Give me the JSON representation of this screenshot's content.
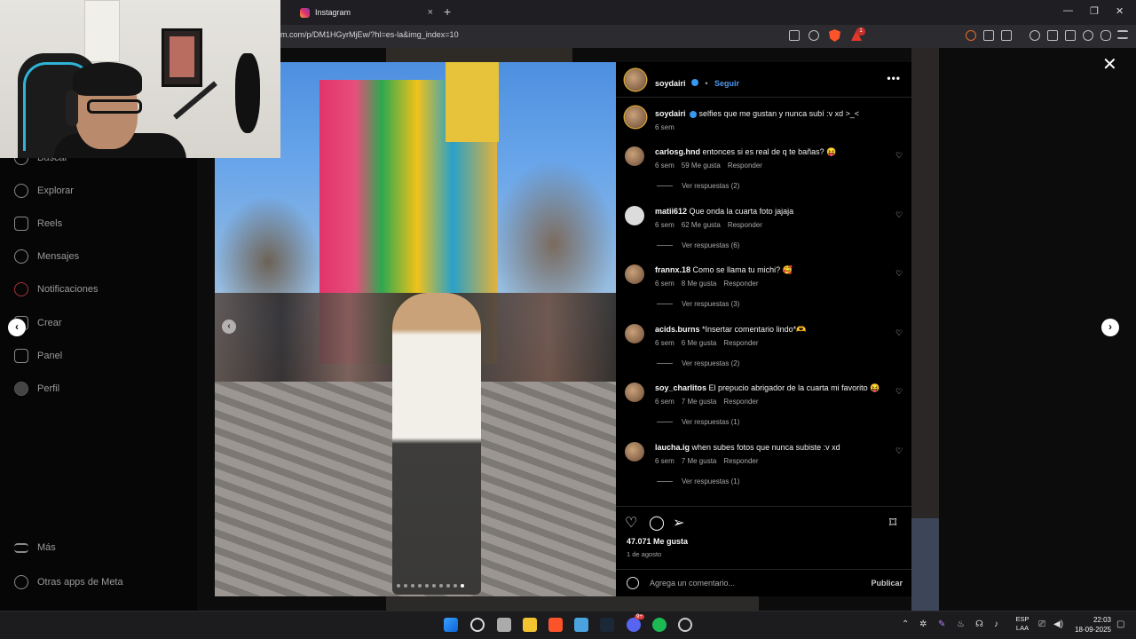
{
  "browser": {
    "tab_title": "Instagram",
    "tab_close": "×",
    "new_tab": "+",
    "url": "m.com/p/DM1HGyrMjEw/?hl=es-la&img_index=10",
    "win_minimize": "—",
    "win_restore": "❐",
    "win_close": "✕",
    "warning_badge": "1"
  },
  "sidebar": {
    "items": [
      {
        "label": "Buscar",
        "icon": "search-icon"
      },
      {
        "label": "Explorar",
        "icon": "compass-icon"
      },
      {
        "label": "Reels",
        "icon": "reels-icon"
      },
      {
        "label": "Mensajes",
        "icon": "messenger-icon"
      },
      {
        "label": "Notificaciones",
        "icon": "heart-icon"
      },
      {
        "label": "Crear",
        "icon": "plus-square-icon"
      },
      {
        "label": "Panel",
        "icon": "dashboard-icon"
      },
      {
        "label": "Perfil",
        "icon": "avatar-icon"
      }
    ],
    "more": "Más",
    "meta_apps": "Otras apps de Meta"
  },
  "modal": {
    "close": "✕",
    "prev": "‹",
    "next": "›",
    "photo_nav_prev": "‹"
  },
  "post": {
    "username": "soydairi",
    "follow": "Seguir",
    "separator": "•",
    "menu": "•••",
    "caption": "selfies que me gustan y nunca subí :v xd >_<",
    "caption_time": "6 sem",
    "likes": "47.071 Me gusta",
    "date": "1 de agosto",
    "comment_placeholder": "Agrega un comentario...",
    "publish": "Publicar"
  },
  "comments": [
    {
      "user": "carlosg.hnd",
      "text": "entonces si es real de q te bañas? 😝",
      "time": "6 sem",
      "likes": "59 Me gusta",
      "reply": "Responder",
      "replies": "Ver respuestas (2)"
    },
    {
      "user": "matii612",
      "text": "Que onda la cuarta foto jajaja",
      "time": "6 sem",
      "likes": "62 Me gusta",
      "reply": "Responder",
      "replies": "Ver respuestas (6)"
    },
    {
      "user": "frannx.18",
      "text": "Como se llama tu michi? 🥰",
      "time": "6 sem",
      "likes": "8 Me gusta",
      "reply": "Responder",
      "replies": "Ver respuestas (3)"
    },
    {
      "user": "acids.burns",
      "text": "*Insertar comentario lindo*🫶",
      "time": "6 sem",
      "likes": "6 Me gusta",
      "reply": "Responder",
      "replies": "Ver respuestas (2)"
    },
    {
      "user": "soy_charlitos",
      "text": "El prepucio abrigador de la cuarta mi favorito 😝",
      "time": "6 sem",
      "likes": "7 Me gusta",
      "reply": "Responder",
      "replies": "Ver respuestas (1)"
    },
    {
      "user": "laucha.ig",
      "text": "when subes fotos que nunca subiste :v xd",
      "time": "6 sem",
      "likes": "7 Me gusta",
      "reply": "Responder",
      "replies": "Ver respuestas (1)"
    }
  ],
  "taskbar": {
    "lang_top": "ESP",
    "lang_bottom": "LAA",
    "time": "22:03",
    "date": "18-09-2025",
    "discord_badge": "9+"
  },
  "colors": {
    "accent_link": "#4f9bf0",
    "verified": "#3897f0",
    "brave": "#fb542b"
  }
}
